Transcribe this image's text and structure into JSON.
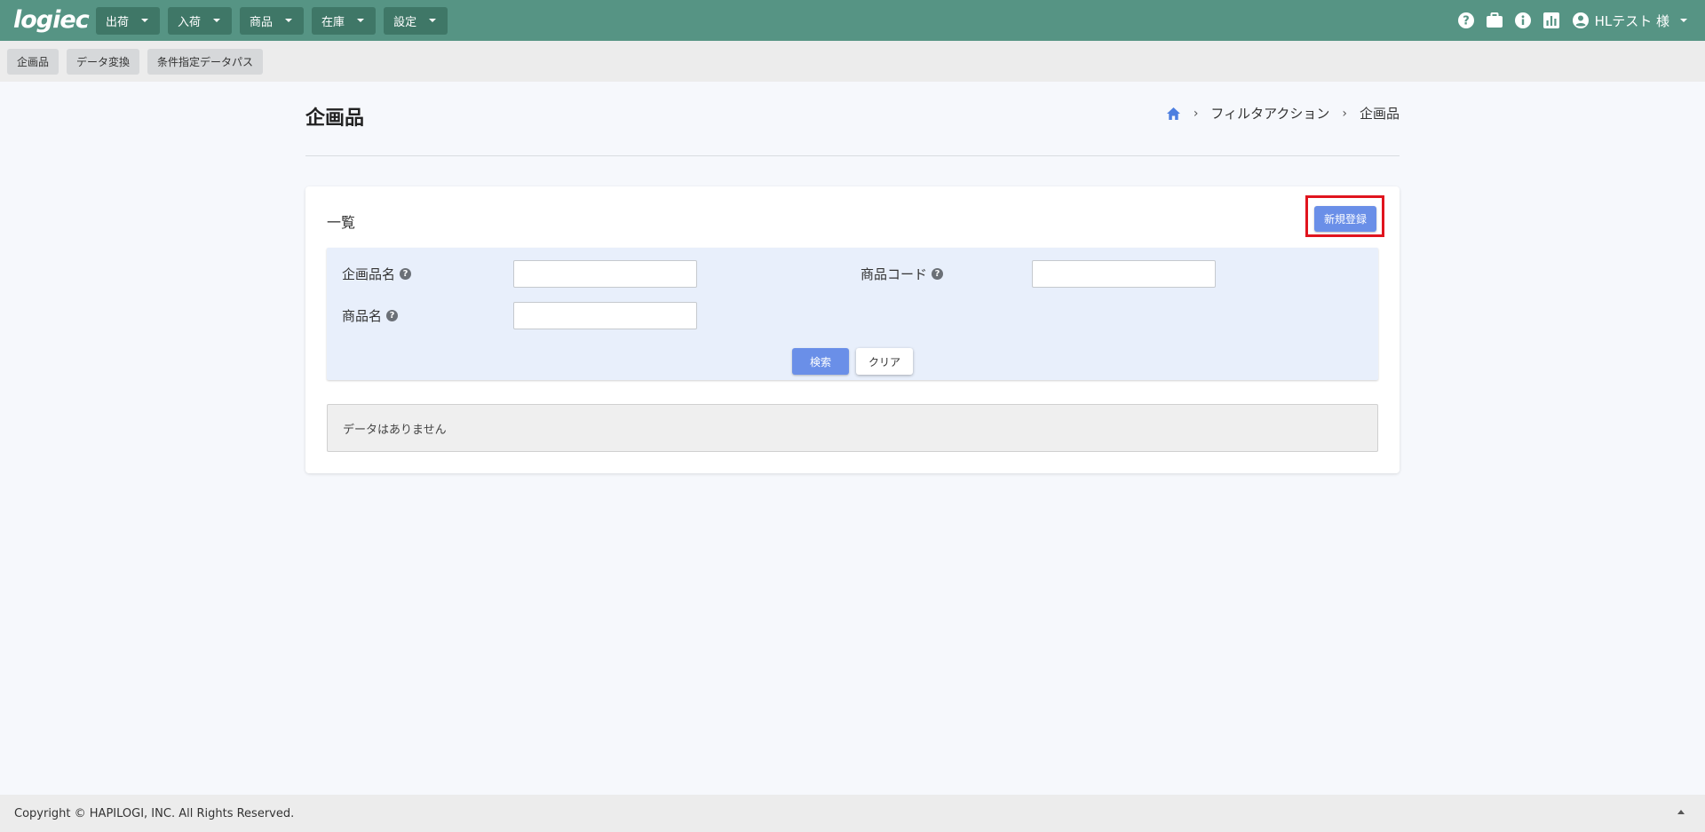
{
  "app": {
    "logo": "logiec"
  },
  "nav": {
    "menus": [
      "出荷",
      "入荷",
      "商品",
      "在庫",
      "設定"
    ],
    "user_name": "HLテスト 様"
  },
  "subnav": [
    "企画品",
    "データ変換",
    "条件指定データパス"
  ],
  "page": {
    "title": "企画品",
    "breadcrumb": [
      "フィルタアクション",
      "企画品"
    ]
  },
  "card": {
    "title": "一覧",
    "new_button": "新規登録",
    "fields": {
      "plan_item_name": {
        "label": "企画品名",
        "value": ""
      },
      "product_code": {
        "label": "商品コード",
        "value": ""
      },
      "product_name": {
        "label": "商品名",
        "value": ""
      }
    },
    "search_button": "検索",
    "clear_button": "クリア",
    "empty_message": "データはありません"
  },
  "footer": {
    "copyright": "Copyright © HAPILOGI, INC. All Rights Reserved."
  },
  "colors": {
    "navbar": "#569484",
    "nav_menu": "#3f7767",
    "primary_button": "#6a8fe8",
    "highlight": "#e0141e",
    "search_panel": "#e8effb"
  }
}
